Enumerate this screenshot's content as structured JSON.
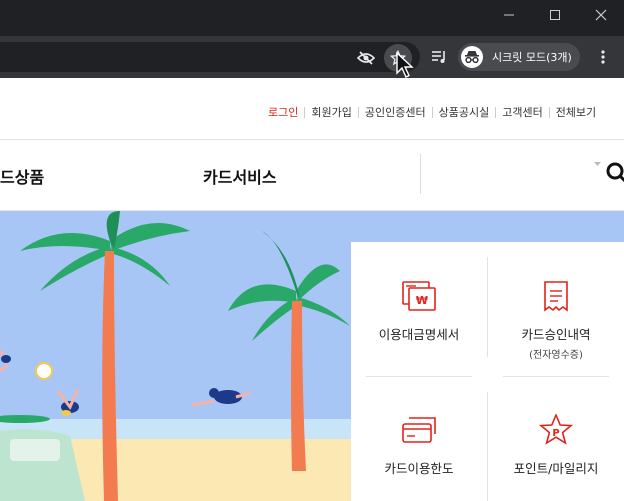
{
  "browser": {
    "window_controls": [
      "minimize-icon",
      "maximize-icon",
      "close-icon"
    ],
    "toolbar_icons": [
      "eye-off-icon",
      "star-icon",
      "playlist-icon",
      "more-vert-icon"
    ],
    "incognito_label": "시크릿 모드(3개)"
  },
  "site": {
    "util_nav": [
      "로그인",
      "회원가입",
      "공인인증센터",
      "상품공시실",
      "고객센터",
      "전체보기"
    ],
    "gnb": [
      "드상품",
      "카드서비스"
    ],
    "quick_menu": [
      {
        "label": "이용대금명세서",
        "sub": "",
        "icon": "bill-icon"
      },
      {
        "label": "카드승인내역",
        "sub": "(전자영수증)",
        "icon": "receipt-icon"
      },
      {
        "label": "카드이용한도",
        "sub": "",
        "icon": "card-limit-icon"
      },
      {
        "label": "포인트/마일리지",
        "sub": "",
        "icon": "point-star-icon"
      }
    ]
  },
  "colors": {
    "accent": "#e2231a",
    "chrome_dark": "#202124",
    "chrome_toolbar": "#35363a",
    "banner_sky": "#a8c6f5"
  }
}
